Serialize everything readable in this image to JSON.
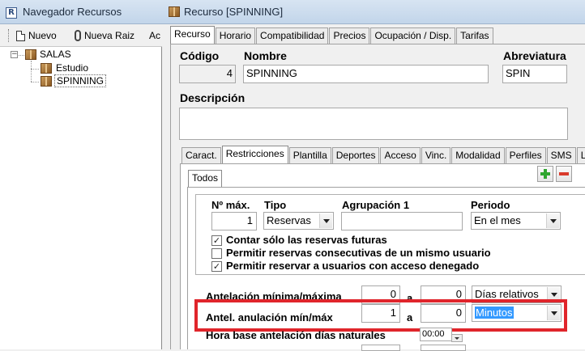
{
  "navigator": {
    "title": "Navegador Recursos",
    "app_icon": "R",
    "toolbar": {
      "nuevo_label": "Nuevo",
      "nueva_raiz_label": "Nueva Raiz",
      "cut_label": "Ac"
    },
    "tree": {
      "root": {
        "label": "SALAS",
        "toggle": "−"
      },
      "children": [
        {
          "label": "Estudio"
        },
        {
          "label": "SPINNING",
          "selected": true
        }
      ]
    }
  },
  "resource": {
    "title": "Recurso [SPINNING]",
    "tabs": [
      {
        "label": "Recurso",
        "active": true
      },
      {
        "label": "Horario"
      },
      {
        "label": "Compatibilidad"
      },
      {
        "label": "Precios"
      },
      {
        "label": "Ocupación / Disp."
      },
      {
        "label": "Tarifas"
      }
    ],
    "codigo": {
      "label": "Código",
      "value": "4"
    },
    "nombre": {
      "label": "Nombre",
      "value": "SPINNING"
    },
    "abreviatura": {
      "label": "Abreviatura",
      "value": "SPIN"
    },
    "descripcion": {
      "label": "Descripción",
      "value": ""
    },
    "inner_tabs": [
      {
        "label": "Caract."
      },
      {
        "label": "Restricciones",
        "active": true
      },
      {
        "label": "Plantilla"
      },
      {
        "label": "Deportes"
      },
      {
        "label": "Acceso"
      },
      {
        "label": "Vinc."
      },
      {
        "label": "Modalidad"
      },
      {
        "label": "Perfiles"
      },
      {
        "label": "SMS"
      },
      {
        "label": "Luz"
      }
    ],
    "sub_tabs": [
      {
        "label": "Todos",
        "active": true
      }
    ],
    "restrictions": {
      "headers": {
        "n_max": "Nº máx.",
        "tipo": "Tipo",
        "agrupacion": "Agrupación 1",
        "periodo": "Periodo"
      },
      "n_max_value": "1",
      "tipo_value": "Reservas",
      "agrupacion_value": "",
      "periodo_value": "En el mes",
      "checkboxes": [
        {
          "label": "Contar sólo las reservas futuras",
          "checked": true
        },
        {
          "label": "Permitir reservas consecutivas de un mismo usuario",
          "checked": false
        },
        {
          "label": "Permitir reservar a usuarios con acceso denegado",
          "checked": true
        }
      ],
      "antelacion": {
        "label": "Antelación mínima/máxima",
        "min": "0",
        "sep": "a",
        "max": "0",
        "unit": "Días relativos"
      },
      "anulacion": {
        "label": "Antel. anulación mín/máx",
        "min": "1",
        "sep": "a",
        "max": "0",
        "unit": "Minutos"
      },
      "hora_base": {
        "label": "Hora base antelación días naturales",
        "value": "00:00"
      }
    }
  },
  "colors": {
    "highlight": "#e0252b",
    "selection": "#3399ff",
    "plus": "#2fa52f",
    "minus": "#d93a2b"
  }
}
